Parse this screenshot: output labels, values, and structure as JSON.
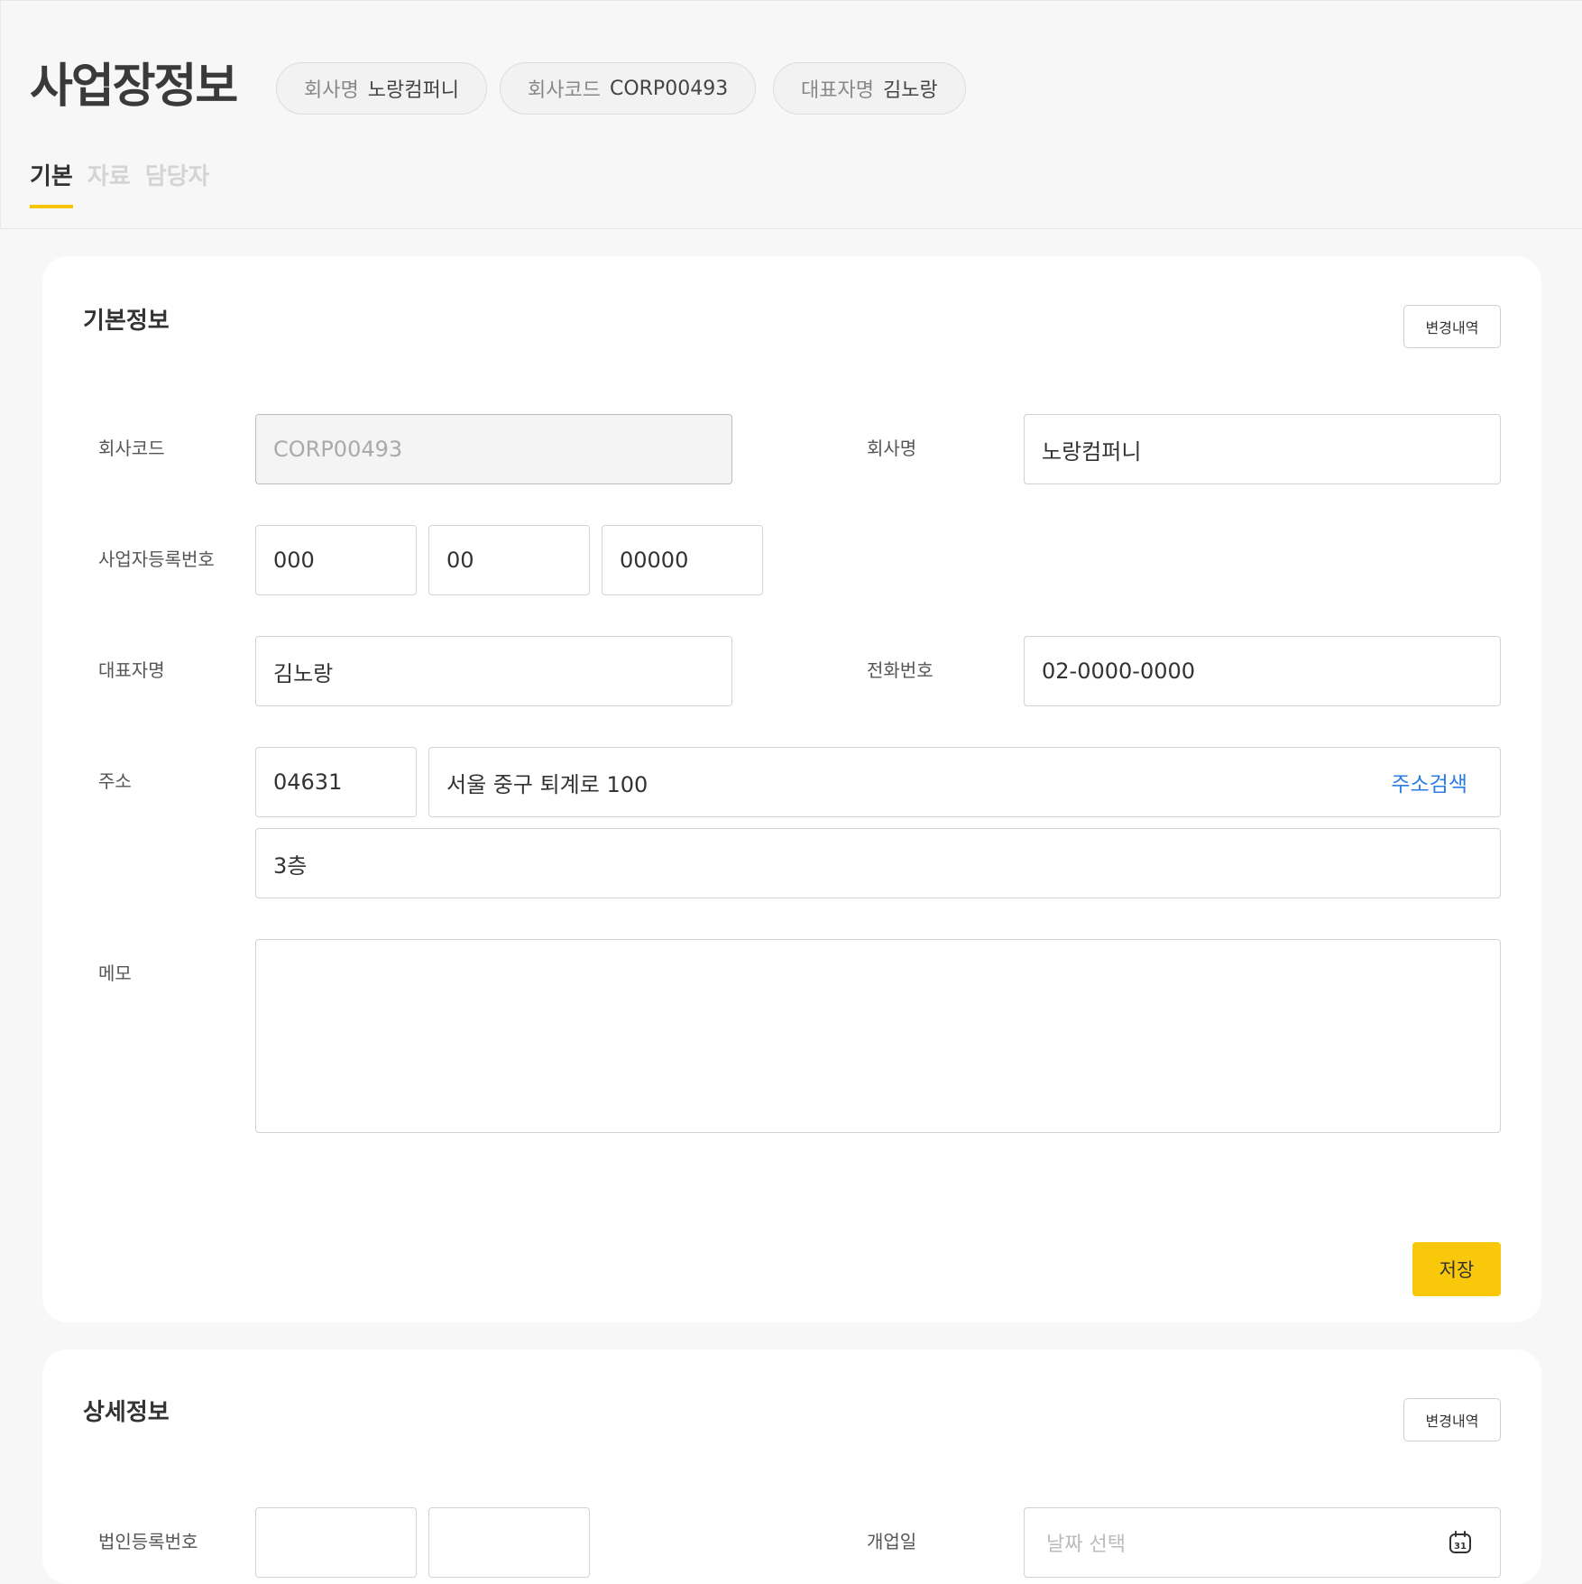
{
  "header": {
    "title": "사업장정보",
    "chips": [
      {
        "key": "회사명",
        "value": "노랑컴퍼니"
      },
      {
        "key": "회사코드",
        "value": "CORP00493"
      },
      {
        "key": "대표자명",
        "value": "김노랑"
      }
    ],
    "tabs": [
      "기본",
      "자료",
      "담당자"
    ],
    "active_tab": "기본"
  },
  "basic": {
    "title": "기본정보",
    "history_label": "변경내역",
    "company_code_label": "회사코드",
    "company_code_value": "CORP00493",
    "company_name_label": "회사명",
    "company_name_value": "노랑컴퍼니",
    "bizno_label": "사업자등록번호",
    "bizno_values": [
      "000",
      "00",
      "00000"
    ],
    "ceo_label": "대표자명",
    "ceo_value": "김노랑",
    "phone_label": "전화번호",
    "phone_value": "02-0000-0000",
    "address_label": "주소",
    "zipcode": "04631",
    "address": "서울 중구 퇴계로 100",
    "address_search_label": "주소검색",
    "address_detail": "3층",
    "memo_label": "메모",
    "memo_value": "",
    "save_label": "저장"
  },
  "detail": {
    "title": "상세정보",
    "history_label": "변경내역",
    "corpno_label": "법인등록번호",
    "corpno_values": [
      "",
      ""
    ],
    "open_date_label": "개업일",
    "open_date_placeholder": "날짜 선택",
    "calendar_day": "31"
  },
  "colors": {
    "accent": "#f9c80a",
    "link": "#2b7de6",
    "tab_underline": "#f7c600"
  },
  "icons": {
    "calendar": "calendar-icon"
  }
}
